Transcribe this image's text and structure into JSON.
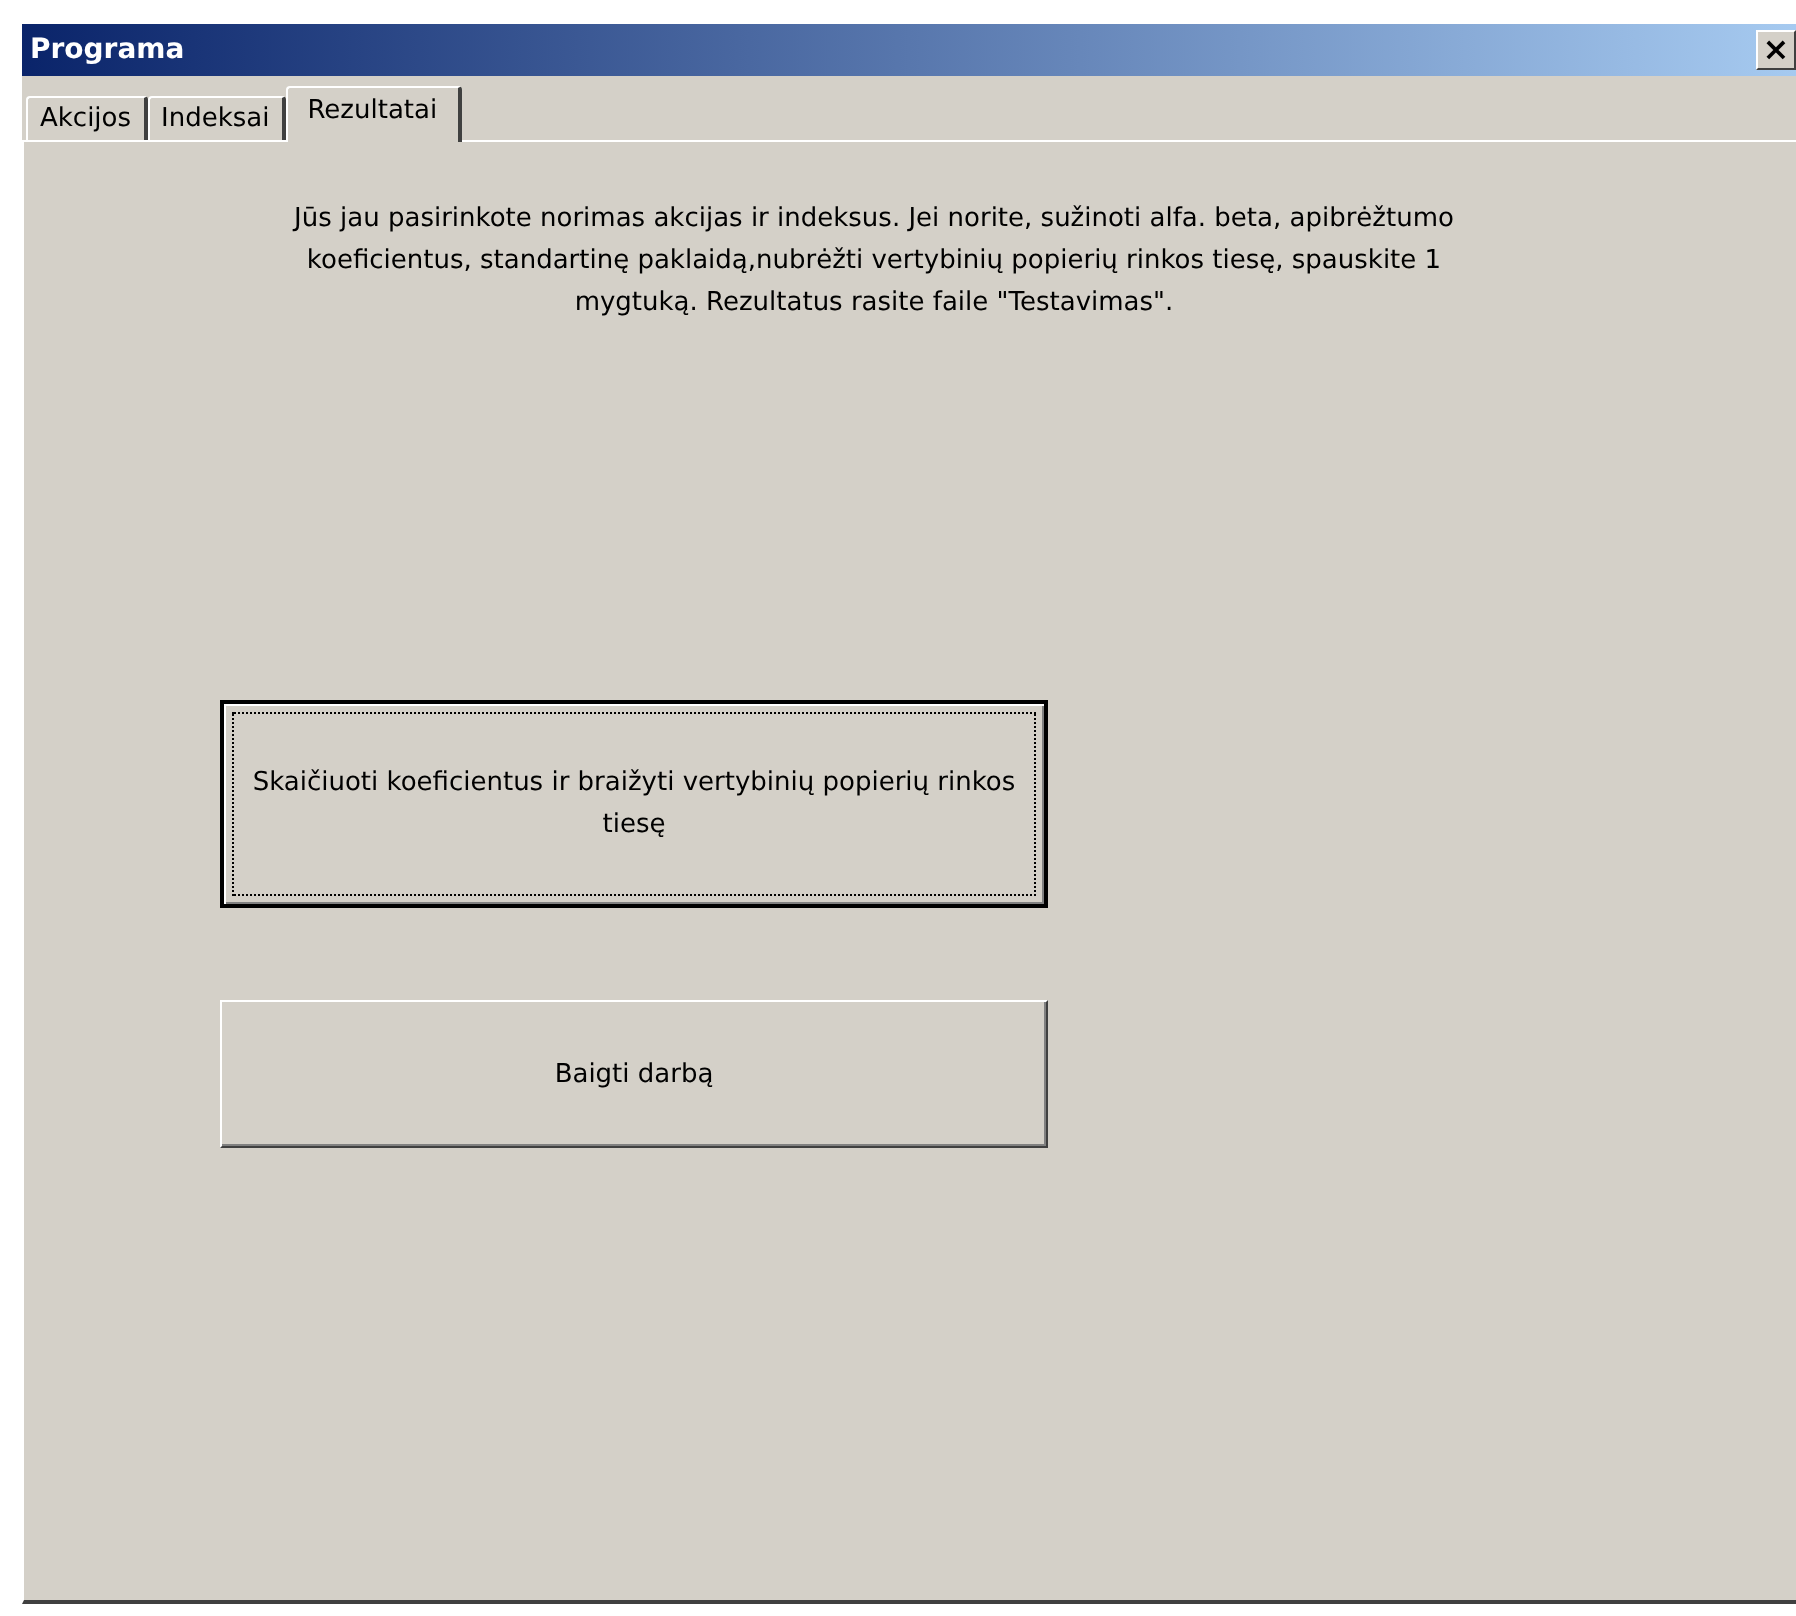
{
  "window": {
    "title": "Programa",
    "close": "×"
  },
  "tabs": [
    {
      "label": "Akcijos",
      "selected": false
    },
    {
      "label": "Indeksai",
      "selected": false
    },
    {
      "label": "Rezultatai",
      "selected": true
    }
  ],
  "message": "Jūs jau pasirinkote norimas akcijas ir indeksus. Jei norite, sužinoti alfa. beta, apibrėžtumo koeficientus, standartinę paklaidą,nubrėžti vertybinių popierių rinkos tiesę, spauskite 1 mygtuką. Rezultatus rasite faile \"Testavimas\".",
  "buttons": [
    {
      "label": "Skaičiuoti koeficientus ir braižyti vertybinių popierių rinkos tiesę",
      "focused": true
    },
    {
      "label": "Baigti darbą",
      "focused": false
    }
  ]
}
